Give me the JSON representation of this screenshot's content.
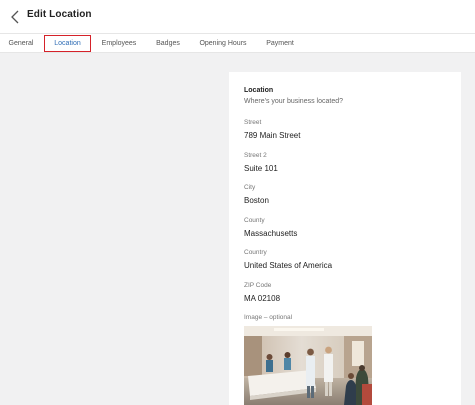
{
  "header": {
    "title": "Edit Location"
  },
  "tabs": [
    {
      "label": "General"
    },
    {
      "label": "Location"
    },
    {
      "label": "Employees"
    },
    {
      "label": "Badges"
    },
    {
      "label": "Opening Hours"
    },
    {
      "label": "Payment"
    }
  ],
  "active_tab": "Location",
  "form": {
    "section_title": "Location",
    "section_subtitle": "Where's your business located?",
    "fields": [
      {
        "label": "Street",
        "value": "789 Main Street"
      },
      {
        "label": "Street 2",
        "value": "Suite 101"
      },
      {
        "label": "City",
        "value": "Boston"
      },
      {
        "label": "County",
        "value": "Massachusetts"
      },
      {
        "label": "Country",
        "value": "United States of America"
      },
      {
        "label": "ZIP Code",
        "value": "MA 02108"
      }
    ],
    "image_label": "Image – optional"
  },
  "colors": {
    "accent": "#2f6db5",
    "highlight": "#d5222a",
    "background": "#f1f1f2"
  }
}
